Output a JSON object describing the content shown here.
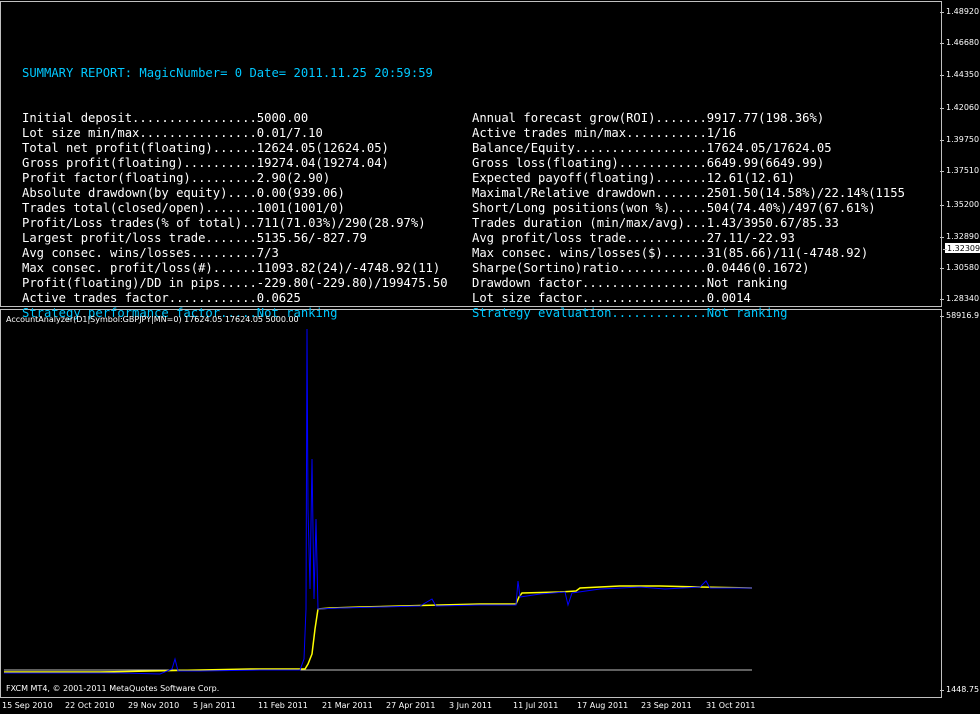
{
  "report": {
    "title": "SUMMARY REPORT: MagicNumber= 0 Date= 2011.11.25 20:59:59",
    "rows": [
      {
        "left": "Initial deposit.................5000.00",
        "right": "Annual forecast grow(ROI).......9917.77(198.36%)",
        "lcolor": "white",
        "rcolor": "white"
      },
      {
        "left": "Lot size min/max................0.01/7.10",
        "right": "Active trades min/max...........1/16",
        "lcolor": "white",
        "rcolor": "white"
      },
      {
        "left": "Total net profit(floating)......12624.05(12624.05)",
        "right": "Balance/Equity..................17624.05/17624.05",
        "lcolor": "white",
        "rcolor": "white"
      },
      {
        "left": "Gross profit(floating)..........19274.04(19274.04)",
        "right": "Gross loss(floating)............6649.99(6649.99)",
        "lcolor": "white",
        "rcolor": "white"
      },
      {
        "left": "Profit factor(floating).........2.90(2.90)",
        "right": "Expected payoff(floating).......12.61(12.61)",
        "lcolor": "white",
        "rcolor": "white"
      },
      {
        "left": "Absolute drawdown(by equity)....0.00(939.06)",
        "right": "Maximal/Relative drawdown.......2501.50(14.58%)/22.14%(1155",
        "lcolor": "white",
        "rcolor": "white"
      },
      {
        "left": "Trades total(closed/open).......1001(1001/0)",
        "right": "Short/Long positions(won %).....504(74.40%)/497(67.61%)",
        "lcolor": "white",
        "rcolor": "white"
      },
      {
        "left": "Profit/Loss trades(% of total)..711(71.03%)/290(28.97%)",
        "right": "Trades duration (min/max/avg)...1.43/3950.67/85.33",
        "lcolor": "white",
        "rcolor": "white"
      },
      {
        "left": "Largest profit/loss trade.......5135.56/-827.79",
        "right": "Avg profit/loss trade...........27.11/-22.93",
        "lcolor": "white",
        "rcolor": "white"
      },
      {
        "left": "Avg consec. wins/losses.........7/3",
        "right": "Max consec. wins/losses($)......31(85.66)/11(-4748.92)",
        "lcolor": "white",
        "rcolor": "white"
      },
      {
        "left": "Max consec. profit/loss(#)......11093.82(24)/-4748.92(11)",
        "right": "Sharpe(Sortino)ratio............0.0446(0.1672)",
        "lcolor": "white",
        "rcolor": "white"
      },
      {
        "left": "Profit(floating)/DD in pips.....-229.80(-229.80)/199475.50",
        "right": "Drawdown factor.................Not ranking",
        "lcolor": "white",
        "rcolor": "white"
      },
      {
        "left": "Active trades factor............0.0625",
        "right": "Lot size factor.................0.0014",
        "lcolor": "white",
        "rcolor": "white"
      },
      {
        "left": "Strategy performance factor.....Not ranking",
        "right": "Strategy evaluation.............Not ranking",
        "lcolor": "cyan",
        "rcolor": "cyan"
      }
    ]
  },
  "price_axis": {
    "ticks": [
      "1.48920",
      "1.46680",
      "1.44350",
      "1.42060",
      "1.39750",
      "1.37510",
      "1.35200",
      "1.32890",
      "1.30580",
      "1.28340"
    ],
    "current": "1.32309"
  },
  "indicator": {
    "label": "AccountAnalyzer(D1|Symbol:GBPJPY|MN=0) 17624.05 17624.05 5000.00",
    "axis_max": "58916.9",
    "axis_min": "1448.75"
  },
  "copyright": "FXCM MT4, © 2001-2011 MetaQuotes Software Corp.",
  "time_axis": [
    "15 Sep 2010",
    "22 Oct 2010",
    "29 Nov 2010",
    "5 Jan 2011",
    "11 Feb 2011",
    "21 Mar 2011",
    "27 Apr 2011",
    "3 Jun 2011",
    "11 Jul 2011",
    "17 Aug 2011",
    "23 Sep 2011",
    "31 Oct 2011"
  ],
  "colors": {
    "background": "#000000",
    "frame": "#c0c0c0",
    "report_title": "#00c8ff",
    "balance_line": "#ffff00",
    "equity_line": "#0000ff",
    "baseline": "#c0c0c0"
  }
}
